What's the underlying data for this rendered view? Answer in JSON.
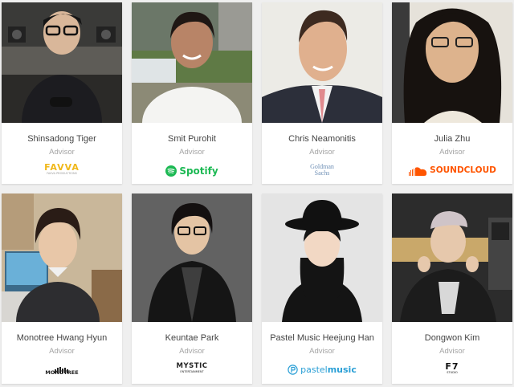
{
  "advisors": [
    {
      "name": "Shinsadong Tiger",
      "role": "Advisor",
      "logo": "FAVVA",
      "logo_icon": "none",
      "logo_color": "#f0b81a"
    },
    {
      "name": "Smit Purohit",
      "role": "Advisor",
      "logo": "Spotify",
      "logo_icon": "spotify-icon",
      "logo_color": "#1db954"
    },
    {
      "name": "Chris Neamonitis",
      "role": "Advisor",
      "logo": "Goldman Sachs",
      "logo_icon": "none",
      "logo_color": "#6e8fb5"
    },
    {
      "name": "Julia Zhu",
      "role": "Advisor",
      "logo": "SOUNDCLOUD",
      "logo_icon": "soundcloud-icon",
      "logo_color": "#ff5500"
    },
    {
      "name": "Monotree Hwang Hyun",
      "role": "Advisor",
      "logo": "MONOTREE",
      "logo_icon": "monotree-icon",
      "logo_color": "#222222"
    },
    {
      "name": "Keuntae Park",
      "role": "Advisor",
      "logo": "MYSTIC",
      "logo_icon": "none",
      "logo_color": "#222222"
    },
    {
      "name": "Pastel Music Heejung Han",
      "role": "Advisor",
      "logo": "pastelmusic",
      "logo_icon": "pastel-p-icon",
      "logo_color": "#2a9fd6"
    },
    {
      "name": "Dongwon Kim",
      "role": "Advisor",
      "logo": "F7",
      "logo_icon": "none",
      "logo_color": "#111111"
    }
  ],
  "logo_parts": {
    "pastel_light": "pastel",
    "pastel_bold": "music",
    "mystic_sub": "ENTERTAINMENT",
    "favva_sub": "FAVVA PRODUCTIONS",
    "goldman_line1": "Goldman",
    "goldman_line2": "Sachs",
    "f7_sub": "STUDIO"
  }
}
